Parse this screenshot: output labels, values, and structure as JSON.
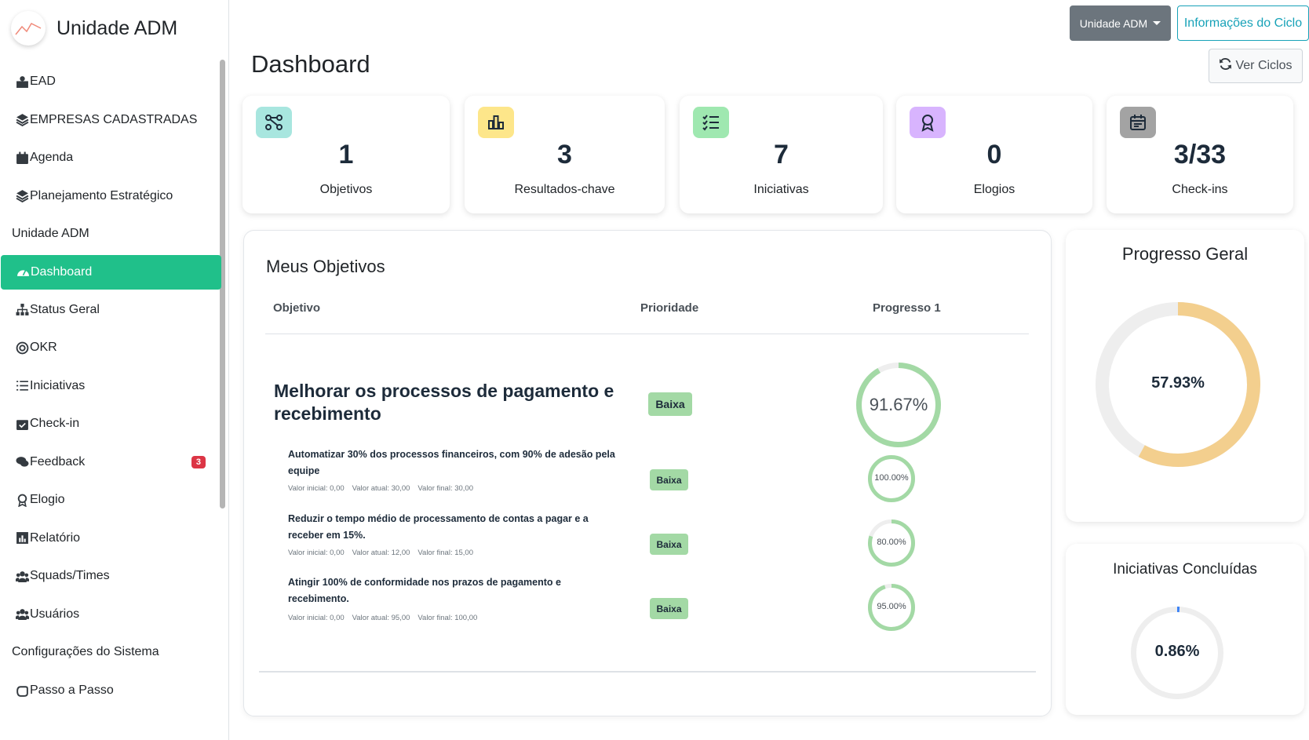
{
  "brand": {
    "title": "Unidade ADM",
    "logo_icon": "chart-line-logo-icon"
  },
  "sidebar": {
    "items": [
      {
        "label": "EAD",
        "icon": "book-reader-icon"
      },
      {
        "label": "EMPRESAS CADASTRADAS",
        "icon": "layers-icon"
      },
      {
        "label": "Agenda",
        "icon": "calendar-icon"
      },
      {
        "label": "Planejamento Estratégico",
        "icon": "layers-icon"
      },
      {
        "label": "Unidade ADM",
        "icon": ""
      },
      {
        "label": "Dashboard",
        "icon": "gauge-icon",
        "active": true
      },
      {
        "label": "Status Geral",
        "icon": "sitemap-icon"
      },
      {
        "label": "OKR",
        "icon": "target-icon"
      },
      {
        "label": "Iniciativas",
        "icon": "list-icon"
      },
      {
        "label": "Check-in",
        "icon": "calendar-check-icon"
      },
      {
        "label": "Feedback",
        "icon": "comments-icon",
        "badge": "3"
      },
      {
        "label": "Elogio",
        "icon": "award-icon"
      },
      {
        "label": "Relatório",
        "icon": "chart-bar-icon"
      },
      {
        "label": "Squads/Times",
        "icon": "users-icon"
      },
      {
        "label": "Usuários",
        "icon": "users-icon"
      },
      {
        "label": "Configurações do Sistema",
        "icon": ""
      },
      {
        "label": "Passo a Passo",
        "icon": "hand-icon"
      }
    ]
  },
  "header": {
    "unidade_button": "Unidade ADM",
    "info_button": "Informações do Ciclo",
    "page_title": "Dashboard",
    "ciclos_button": "Ver Ciclos"
  },
  "stats": [
    {
      "value": "1",
      "label": "Objetivos",
      "icon": "nodes-icon",
      "color": "#a8e6df"
    },
    {
      "value": "3",
      "label": "Resultados-chave",
      "icon": "chart-bar-icon",
      "color": "#fde68a"
    },
    {
      "value": "7",
      "label": "Iniciativas",
      "icon": "list-check-icon",
      "color": "#9fe8b0"
    },
    {
      "value": "0",
      "label": "Elogios",
      "icon": "award-icon",
      "color": "#d8b4fe"
    },
    {
      "value": "3/33",
      "label": "Check-ins",
      "icon": "calendar-icon",
      "color": "#a3a3a3"
    }
  ],
  "objectives": {
    "title": "Meus Objetivos",
    "columns": [
      "Objetivo",
      "Prioridade",
      "Progresso 1"
    ],
    "objective": {
      "title": "Melhorar os processos de pagamento e recebimento",
      "priority": "Baixa",
      "progress_label": "91.67%",
      "progress": 0.9167
    },
    "key_results": [
      {
        "title": "Automatizar 30% dos processos financeiros, com 90% de adesão pela equipe",
        "initial": "Valor inicial: 0,00",
        "current": "Valor atual: 30,00",
        "final": "Valor final: 30,00",
        "priority": "Baixa",
        "progress_label": "100.00%",
        "progress": 1.0
      },
      {
        "title": "Reduzir o tempo médio de processamento de contas a pagar e a receber em 15%.",
        "initial": "Valor inicial: 0,00",
        "current": "Valor atual: 12,00",
        "final": "Valor final: 15,00",
        "priority": "Baixa",
        "progress_label": "80.00%",
        "progress": 0.8
      },
      {
        "title": "Atingir 100% de conformidade nos prazos de pagamento e recebimento.",
        "initial": "Valor inicial: 0,00",
        "current": "Valor atual: 95,00",
        "final": "Valor final: 100,00",
        "priority": "Baixa",
        "progress_label": "95.00%",
        "progress": 0.95
      }
    ]
  },
  "progresso_geral": {
    "title": "Progresso Geral",
    "value_label": "57.93%",
    "value": 0.5793,
    "color": "#f3cf8e"
  },
  "iniciativas_concluidas": {
    "title": "Iniciativas Concluídas",
    "value_label": "0.86%",
    "value": 0.0086,
    "color": "#3b82f6"
  },
  "colors": {
    "accent": "#20c08a",
    "ring_green": "#a3d9a5",
    "badge_red": "#dc3545",
    "info": "#17a2b8"
  }
}
